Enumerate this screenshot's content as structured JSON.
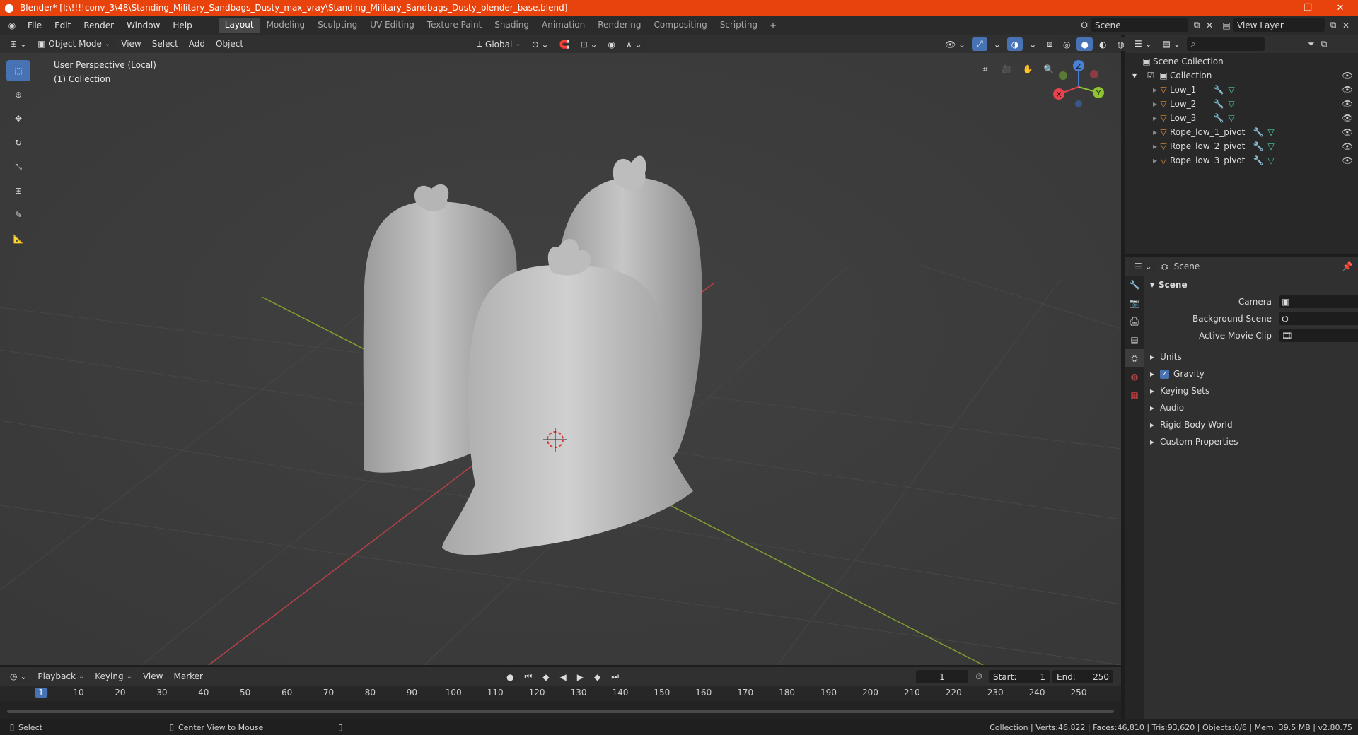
{
  "title": "Blender* [I:\\!!!!conv_3\\48\\Standing_Military_Sandbags_Dusty_max_vray\\Standing_Military_Sandbags_Dusty_blender_base.blend]",
  "menu": [
    "File",
    "Edit",
    "Render",
    "Window",
    "Help"
  ],
  "workspaces": [
    "Layout",
    "Modeling",
    "Sculpting",
    "UV Editing",
    "Texture Paint",
    "Shading",
    "Animation",
    "Rendering",
    "Compositing",
    "Scripting"
  ],
  "active_workspace": "Layout",
  "scene_name": "Scene",
  "view_layer": "View Layer",
  "viewport_header": {
    "mode": "Object Mode",
    "menus": [
      "View",
      "Select",
      "Add",
      "Object"
    ],
    "orientation": "Global"
  },
  "viewport": {
    "perspective": "User Perspective (Local)",
    "collection": "(1) Collection"
  },
  "gizmo": {
    "x": "X",
    "y": "Y",
    "z": "Z"
  },
  "outliner": {
    "root": "Scene Collection",
    "collection": "Collection",
    "items": [
      "Low_1",
      "Low_2",
      "Low_3",
      "Rope_low_1_pivot",
      "Rope_low_2_pivot",
      "Rope_low_3_pivot"
    ]
  },
  "properties": {
    "context": "Scene",
    "panel": "Scene",
    "fields": [
      "Camera",
      "Background Scene",
      "Active Movie Clip"
    ],
    "sections": [
      "Units",
      "Gravity",
      "Keying Sets",
      "Audio",
      "Rigid Body World",
      "Custom Properties"
    ],
    "gravity_checked": true
  },
  "timeline": {
    "menus": [
      "Playback",
      "Keying",
      "View",
      "Marker"
    ],
    "current_frame": "1",
    "start_label": "Start:",
    "start": "1",
    "end_label": "End:",
    "end": "250",
    "ticks": [
      "1",
      "10",
      "20",
      "30",
      "40",
      "50",
      "60",
      "70",
      "80",
      "90",
      "100",
      "110",
      "120",
      "130",
      "140",
      "150",
      "160",
      "170",
      "180",
      "190",
      "200",
      "210",
      "220",
      "230",
      "240",
      "250"
    ]
  },
  "status": {
    "left": "Select",
    "middle": "Center View to Mouse",
    "right": "Collection | Verts:46,822 | Faces:46,810 | Tris:93,620 | Objects:0/6 | Mem: 39.5 MB | v2.80.75"
  },
  "colors": {
    "accent": "#4772b3",
    "titlebar": "#e8430d",
    "x_axis": "#e8424f",
    "y_axis": "#8ec334",
    "z_axis": "#4a80d4"
  }
}
